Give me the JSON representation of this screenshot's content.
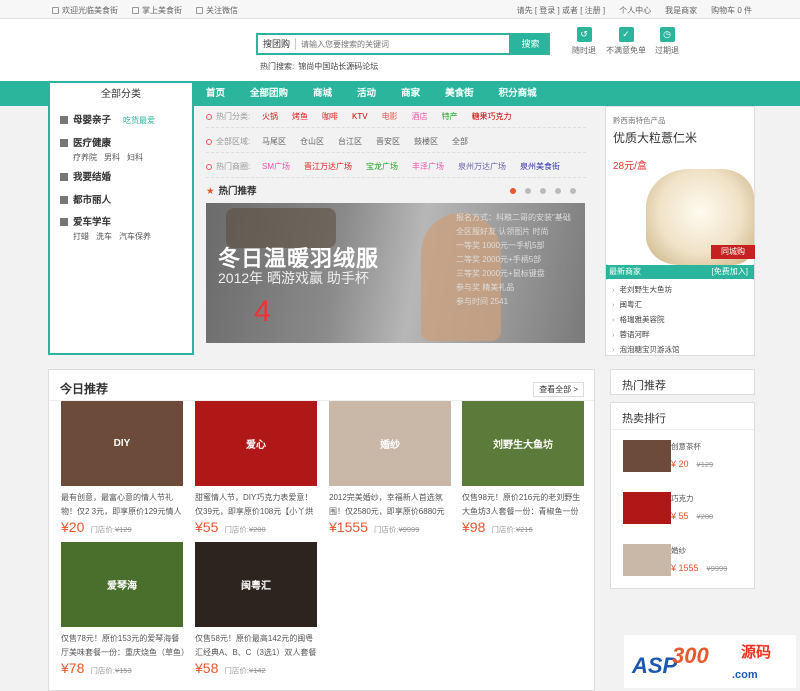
{
  "topbar": {
    "welcome": "欢迎光临美食街",
    "mobile": "掌上美食街",
    "follow": "关注微信",
    "login_prompt": "请先 [ 登录 ] 或者 [ 注册 ]",
    "user_center": "个人中心",
    "merchant": "我是商家",
    "cart": "购物车 0 件"
  },
  "search": {
    "type_label": "搜团购",
    "placeholder": "请输入您要搜索的关键词",
    "button": "搜索",
    "hot_label": "热门搜索:",
    "hot_items": [
      "锦尚中国站长源码论坛"
    ]
  },
  "guarantees": [
    "随时退",
    "不满意免单",
    "过期退"
  ],
  "nav": {
    "all_categories": "全部分类",
    "items": [
      "首页",
      "全部团购",
      "商城",
      "活动",
      "商家",
      "美食街",
      "积分商城"
    ]
  },
  "categories": [
    {
      "name": "母婴亲子",
      "tag": "吃货最爱",
      "subs": []
    },
    {
      "name": "医疗健康",
      "tag": "",
      "subs": [
        "疗养院",
        "男科",
        "妇科"
      ]
    },
    {
      "name": "我要结婚",
      "tag": "",
      "subs": []
    },
    {
      "name": "都市丽人",
      "tag": "",
      "subs": []
    },
    {
      "name": "爱车学车",
      "tag": "",
      "subs": [
        "打蜡",
        "洗车",
        "汽车保养"
      ]
    }
  ],
  "filters": {
    "category_label": "热门分类:",
    "category_values": [
      "火锅",
      "烤鱼",
      "咖啡",
      "KTV",
      "电影",
      "酒店",
      "特产",
      "糖果巧克力"
    ],
    "category_colors": [
      "#d22",
      "#d22",
      "#d22",
      "#c00",
      "#e55",
      "#e5a",
      "#2a2",
      "#c00"
    ],
    "area_label": "全部区域:",
    "area_values": [
      "马尾区",
      "仓山区",
      "台江区",
      "晋安区",
      "鼓楼区",
      "全部"
    ],
    "biz_label": "热门商圈:",
    "biz_values": [
      "SM广场",
      "晋江万达广场",
      "宝龙广场",
      "丰泽广场",
      "泉州万达广场",
      "泉州美食街"
    ],
    "biz_colors": [
      "#e5a",
      "#d22",
      "#2a2",
      "#e5a",
      "#66a",
      "#33a"
    ]
  },
  "hot_recommend": {
    "title": "热门推荐",
    "slides": 5,
    "active_slide": 1,
    "banner": {
      "headline": "冬日温暖羽绒服",
      "sub": "2012年 晒游戏赢 助手杯",
      "number": "4",
      "rules": "报名方式：科粮二哥的安装\"基础\n全区服好友 认领图片 时尚\n一等奖 1000元一手机5部\n二等奖 2000元+手柄5部\n三等奖 2000元+鼠标键盘\n参与奖 精美礼品\n参与时间 2541"
    }
  },
  "side_ad": {
    "tag": "黔西南特色产品",
    "title": "优质大粒薏仁米",
    "price": "28元/盒",
    "buy": "同城购"
  },
  "new_merchants": {
    "title": "最新商家",
    "join": "[免费加入]",
    "items": [
      "老刘野生大鱼坊",
      "闽粤汇",
      "格瑞雅美容院",
      "蓉语河畔",
      "泡泡糖宝贝游泳馆"
    ]
  },
  "today": {
    "title": "今日推荐",
    "more": "查看全部 >",
    "store_price_label": "门店价:",
    "deals": [
      {
        "img_text": "DIY",
        "bg": "#6d4b3a",
        "desc": "最有创意，最富心意的情人节礼物！仅2 3元，即享原价129元情人节DIY实",
        "price": "¥20",
        "orig": "¥129"
      },
      {
        "img_text": "爱心",
        "bg": "#b01818",
        "desc": "甜蜜情人节，DIY巧克力表爱意！仅39元，即享原价108元【小丫烘焙",
        "price": "¥55",
        "orig": "¥200"
      },
      {
        "img_text": "婚纱",
        "bg": "#c9b7a8",
        "desc": "2012完美婚纱，幸福新人首选氛围！仅2580元，即享原价6880元【凯蒂",
        "price": "¥1555",
        "orig": "¥9999"
      },
      {
        "img_text": "刘野生大鱼坊",
        "bg": "#5c7a3a",
        "desc": "仅售98元！原价216元的老刘野生大鱼坊3人套餐一份：青椒鱼一份+啤",
        "price": "¥98",
        "orig": "¥216"
      },
      {
        "img_text": "爱琴海",
        "bg": "#4a6e2c",
        "desc": "仅售78元！原价153元的爱琴海餐厅美味套餐一份：重庆烧鱼（草鱼）一",
        "price": "¥78",
        "orig": "¥153"
      },
      {
        "img_text": "闽粤汇",
        "bg": "#2d2420",
        "desc": "仅售58元！原价最高142元的闽粤汇经典A、B、C（3选1）双人套餐一",
        "price": "¥58",
        "orig": "¥142"
      }
    ]
  },
  "side_boxes": {
    "hot_recommend": "热门推荐",
    "hot_sale": "热卖排行",
    "items": [
      {
        "name": "创意茶杯",
        "bg": "#6d4b3a",
        "price": "¥ 20",
        "orig": "¥129"
      },
      {
        "name": "巧克力",
        "bg": "#b01818",
        "price": "¥ 55",
        "orig": "¥200"
      },
      {
        "name": "婚纱",
        "bg": "#c9b7a8",
        "price": "¥ 1555",
        "orig": "¥9999"
      }
    ]
  },
  "watermark": {
    "a": "ASP",
    "b": "300",
    "c": "源码",
    "d": ".com"
  }
}
